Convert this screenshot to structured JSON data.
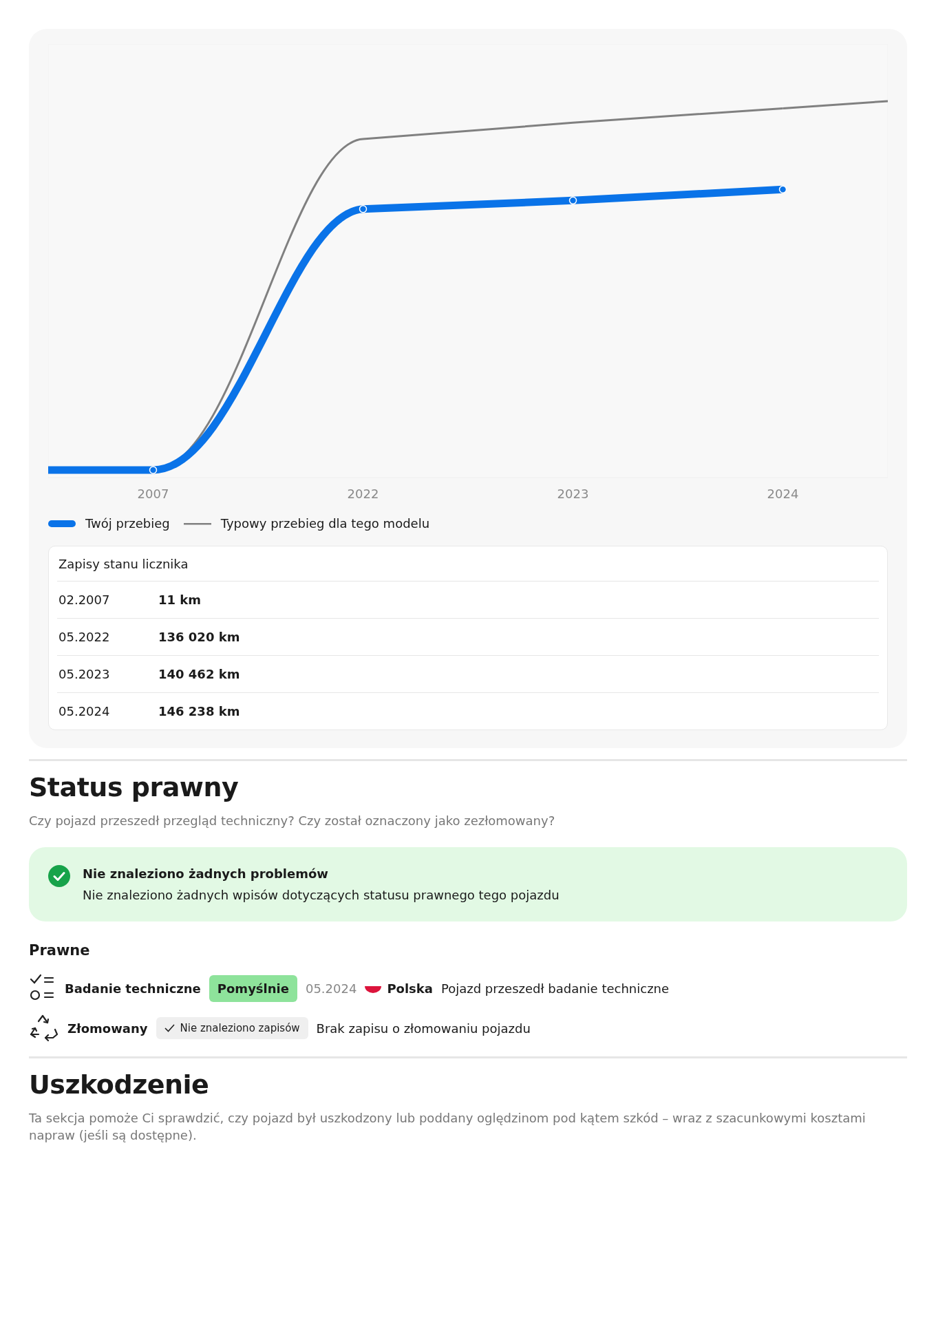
{
  "mileage_chart": {
    "x_labels": [
      "2007",
      "2022",
      "2023",
      "2024"
    ],
    "legend": [
      {
        "label": "Twój przebieg",
        "kind": "thick",
        "color": "#0a73e8"
      },
      {
        "label": "Typowy przebieg dla tego modelu",
        "kind": "thin",
        "color": "#808080"
      }
    ]
  },
  "odometer_records": {
    "title": "Zapisy stanu licznika",
    "rows": [
      {
        "date": "02.2007",
        "mileage": "11 km"
      },
      {
        "date": "05.2022",
        "mileage": "136 020 km"
      },
      {
        "date": "05.2023",
        "mileage": "140 462 km"
      },
      {
        "date": "05.2024",
        "mileage": "146 238 km"
      }
    ]
  },
  "legal_status": {
    "title": "Status prawny",
    "subtitle": "Czy pojazd przeszedł przegląd techniczny? Czy został oznaczony jako zezłomowany?",
    "alert": {
      "title": "Nie znaleziono żadnych problemów",
      "text": "Nie znaleziono żadnych wpisów dotyczących statusu prawnego tego pojazdu"
    },
    "group_title": "Prawne",
    "items": [
      {
        "kind": "inspection",
        "label": "Badanie techniczne",
        "badge": {
          "text": "Pomyślnie",
          "kind": "success"
        },
        "date": "05.2024",
        "country": "Polska",
        "description": "Pojazd przeszedł badanie techniczne"
      },
      {
        "kind": "scrapped",
        "label": "Złomowany",
        "badge": {
          "text": "Nie znaleziono zapisów",
          "kind": "neutral"
        },
        "description": "Brak zapisu o złomowaniu pojazdu"
      }
    ]
  },
  "damage": {
    "title": "Uszkodzenie",
    "text": "Ta sekcja pomoże Ci sprawdzić, czy pojazd był uszkodzony lub poddany oględzinom pod kątem szkód – wraz z szacunkowymi kosztami napraw (jeśli są dostępne)."
  }
}
